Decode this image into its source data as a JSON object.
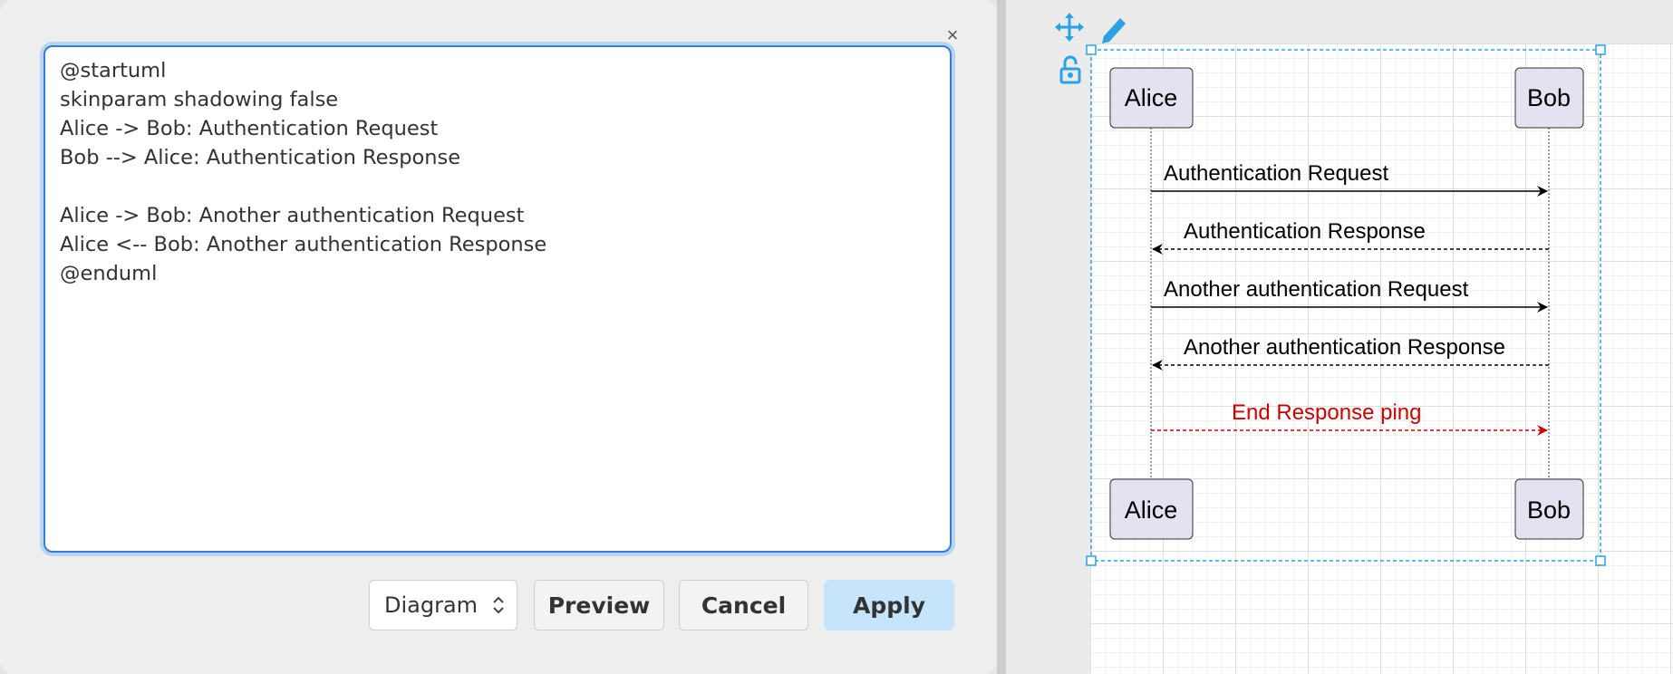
{
  "dialog": {
    "close_label": "×",
    "editor_text": "@startuml\nskinparam shadowing false\nAlice -> Bob: Authentication Request\nBob --> Alice: Authentication Response\n\nAlice -> Bob: Another authentication Request\nAlice <-- Bob: Another authentication Response\n@enduml",
    "format_select": {
      "value": "Diagram",
      "icon": "up-down-chevron-icon"
    },
    "preview_label": "Preview",
    "cancel_label": "Cancel",
    "apply_label": "Apply"
  },
  "canvas": {
    "toolbar_icons": [
      "move-icon",
      "edit-pencil-icon",
      "unlock-icon"
    ],
    "diagram": {
      "participants": [
        "Alice",
        "Bob"
      ],
      "messages": [
        {
          "from": "Alice",
          "to": "Bob",
          "label": "Authentication Request",
          "style": "solid",
          "color": "#000000"
        },
        {
          "from": "Bob",
          "to": "Alice",
          "label": "Authentication Response",
          "style": "dashed",
          "color": "#000000"
        },
        {
          "from": "Alice",
          "to": "Bob",
          "label": "Another authentication Request",
          "style": "solid",
          "color": "#000000"
        },
        {
          "from": "Bob",
          "to": "Alice",
          "label": "Another authentication Response",
          "style": "dashed",
          "color": "#000000"
        },
        {
          "from": "Alice",
          "to": "Bob",
          "label": "End Response ping",
          "style": "dashed",
          "color": "#cc0000"
        }
      ]
    }
  },
  "colors": {
    "accent": "#2f7fd8",
    "selection": "#29a3e6",
    "apply_bg": "#c6e5fb",
    "participant_fill": "#e2e2f0"
  }
}
